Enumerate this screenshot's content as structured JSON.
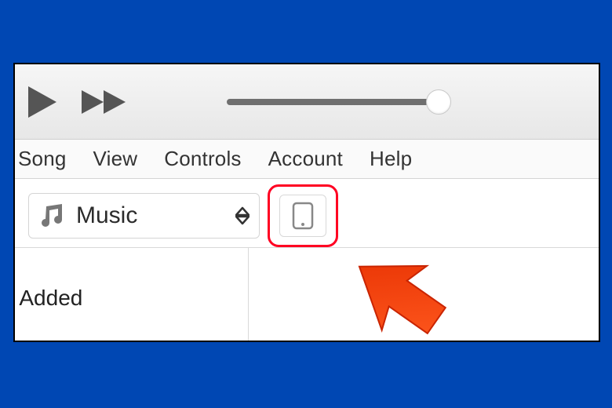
{
  "menubar": {
    "items": [
      "Song",
      "View",
      "Controls",
      "Account",
      "Help"
    ]
  },
  "library_picker": {
    "label": "Music"
  },
  "sidebar": {
    "item_label": "ently Added"
  },
  "slider": {
    "value": 100
  },
  "icons": {
    "play": "play-icon",
    "fast_forward": "fast-forward-icon",
    "music_note": "music-note-icon",
    "device": "device-icon"
  },
  "annotation": {
    "highlight_color": "#ff0022",
    "arrow_color": "#ff3e17"
  }
}
